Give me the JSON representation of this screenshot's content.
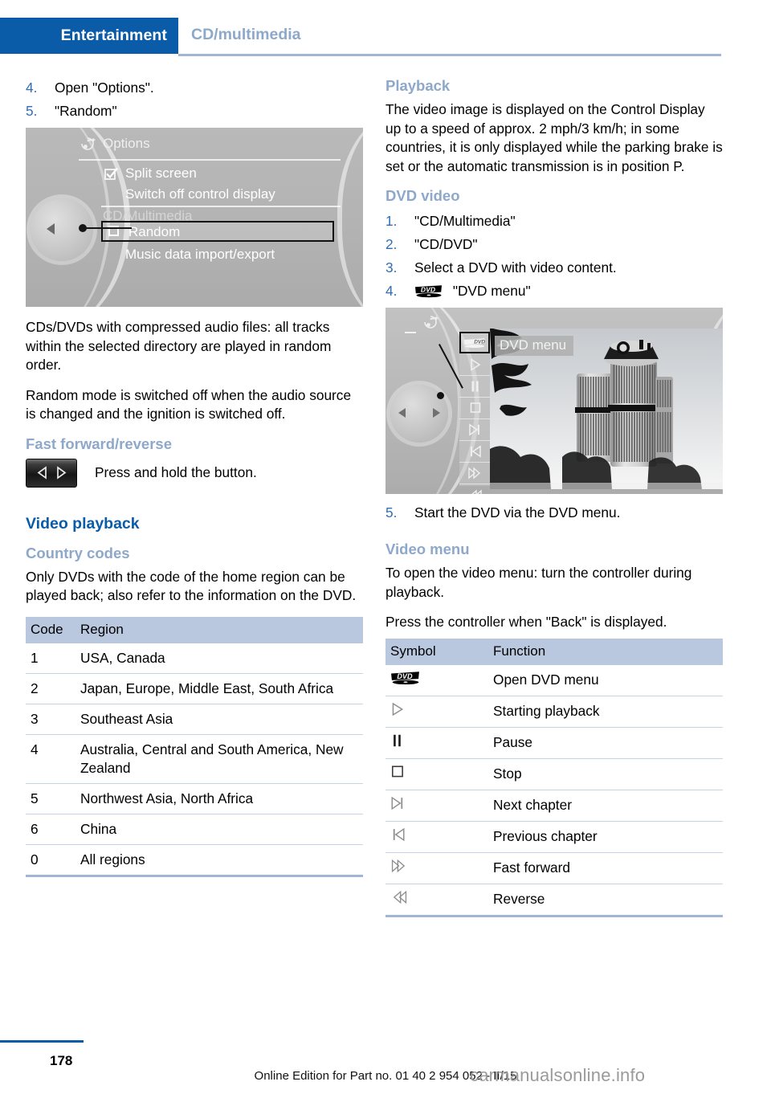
{
  "header": {
    "chapter": "Entertainment",
    "section": "CD/multimedia"
  },
  "left_column": {
    "random_steps": [
      {
        "num": "4.",
        "text": "Open \"Options\"."
      },
      {
        "num": "5.",
        "text": "\"Random\""
      }
    ],
    "options_screenshot": {
      "title": "Options",
      "title_icon": "multimedia-note-icon",
      "items": [
        {
          "label": "Split screen",
          "checkbox": "checked"
        },
        {
          "label": "Switch off control display",
          "checkbox": "none"
        },
        {
          "label": "CD/Multimedia",
          "checkbox": "none",
          "style": "dim"
        },
        {
          "label": "Random",
          "checkbox": "unchecked",
          "selected": true
        },
        {
          "label": "Music data import/export",
          "checkbox": "none"
        }
      ]
    },
    "paragraphs": [
      "CDs/DVDs with compressed audio files: all tracks within the selected directory are played in random order.",
      "Random mode is switched off when the audio source is changed and the ignition is switched off."
    ],
    "fast_forward": {
      "heading": "Fast forward/reverse",
      "button_icon": "prev-next-rocker-button",
      "text": "Press and hold the button."
    },
    "video_playback_heading": "Video playback",
    "country_codes": {
      "heading": "Country codes",
      "intro": "Only DVDs with the code of the home region can be played back; also refer to the information on the DVD.",
      "columns": [
        "Code",
        "Region"
      ],
      "rows": [
        [
          "1",
          "USA, Canada"
        ],
        [
          "2",
          "Japan, Europe, Middle East, South Africa"
        ],
        [
          "3",
          "Southeast Asia"
        ],
        [
          "4",
          "Australia, Central and South America, New Zealand"
        ],
        [
          "5",
          "Northwest Asia, North Africa"
        ],
        [
          "6",
          "China"
        ],
        [
          "0",
          "All regions"
        ]
      ]
    }
  },
  "right_column": {
    "playback": {
      "heading": "Playback",
      "text": "The video image is displayed on the Control Display up to a speed of approx. 2 mph/3 km/h; in some countries, it is only displayed while the parking brake is set or the automatic transmission is in position P."
    },
    "dvd_video": {
      "heading": "DVD video",
      "steps": [
        {
          "num": "1.",
          "text": "\"CD/Multimedia\"",
          "icon": null
        },
        {
          "num": "2.",
          "text": "\"CD/DVD\"",
          "icon": null
        },
        {
          "num": "3.",
          "text": "Select a DVD with video content.",
          "icon": null
        },
        {
          "num": "4.",
          "text": "\"DVD menu\"",
          "icon": "dvd-logo-icon"
        }
      ],
      "last_step": {
        "num": "5.",
        "text": "Start the DVD via the DVD menu."
      }
    },
    "dvd_screenshot": {
      "title_icon": "multimedia-note-icon",
      "menu_label": "DVD menu",
      "controls": [
        "dvd-logo-icon",
        "play-icon",
        "pause-icon",
        "stop-icon",
        "next-chapter-icon",
        "previous-chapter-icon",
        "fast-forward-icon",
        "reverse-icon"
      ],
      "image_caption": "BMW Vierzylinder tower building photo"
    },
    "video_menu": {
      "heading": "Video menu",
      "paragraphs": [
        "To open the video menu: turn the controller during playback.",
        "Press the controller when \"Back\" is displayed."
      ],
      "columns": [
        "Symbol",
        "Function"
      ],
      "rows": [
        {
          "icon": "dvd-logo-icon",
          "function": "Open DVD menu"
        },
        {
          "icon": "play-icon",
          "function": "Starting playback"
        },
        {
          "icon": "pause-icon",
          "function": "Pause"
        },
        {
          "icon": "stop-icon",
          "function": "Stop"
        },
        {
          "icon": "next-chapter-icon",
          "function": "Next chapter"
        },
        {
          "icon": "previous-chapter-icon",
          "function": "Previous chapter"
        },
        {
          "icon": "fast-forward-icon",
          "function": "Fast forward"
        },
        {
          "icon": "reverse-icon",
          "function": "Reverse"
        }
      ]
    }
  },
  "footer": {
    "page_number": "178",
    "edition": "Online Edition for Part no. 01 40 2 954 052 - II/15",
    "watermark": "carmanualsonline.info"
  },
  "colors": {
    "brand_blue": "#0b5ca8",
    "light_blue": "#8da8ca",
    "table_header": "#b9c8de",
    "rule_blue": "#9fb6d6"
  }
}
